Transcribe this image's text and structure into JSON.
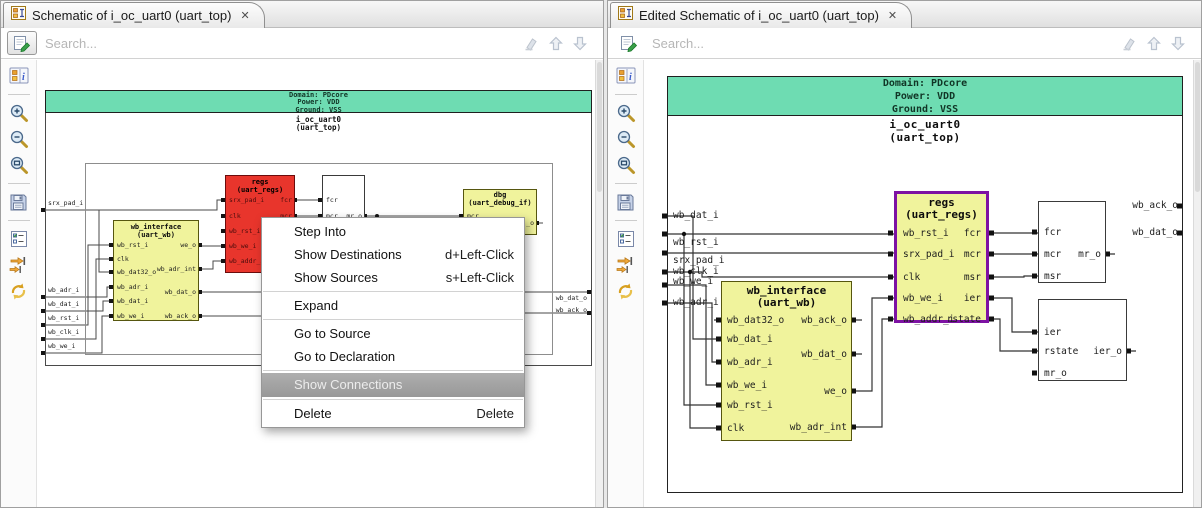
{
  "icons": {
    "close": "✕"
  },
  "left_panel": {
    "tab_title": "Schematic of i_oc_uart0 (uart_top)",
    "search_placeholder": "Search..."
  },
  "right_panel": {
    "tab_title": "Edited Schematic of i_oc_uart0 (uart_top)",
    "search_placeholder": "Search..."
  },
  "header_block": {
    "domain": "Domain: PDcore",
    "power": "Power: VDD",
    "ground": "Ground: VSS",
    "instance": "i_oc_uart0",
    "module": "(uart_top)"
  },
  "left_schematic": {
    "inputs": [
      "srx_pad_i",
      "wb_adr_i",
      "wb_dat_i",
      "wb_rst_i",
      "wb_clk_i",
      "wb_we_i"
    ],
    "outputs": [
      "wb_dat_o",
      "wb_ack_o"
    ],
    "wb_interface": {
      "title": "wb_interface",
      "subtitle": "(uart_wb)",
      "left_ports": [
        "wb_rst_i",
        "clk",
        "wb_dat32_o",
        "wb_adr_i",
        "wb_dat_i",
        "wb_we_i"
      ],
      "right_ports": [
        "we_o",
        "wb_adr_int",
        "wb_dat_o",
        "wb_ack_o"
      ]
    },
    "regs": {
      "title": "regs",
      "subtitle": "(uart_regs)",
      "left_ports": [
        "srx_pad_i",
        "clk",
        "wb_rst_i",
        "wb_we_i",
        "wb_addr_i"
      ],
      "right_ports": [
        "fcr",
        "mcr"
      ]
    },
    "cell": {
      "left_ports": [
        "fcr",
        "mcr"
      ],
      "right_ports": [
        "mr_o"
      ]
    },
    "dbg": {
      "title": "dbg",
      "subtitle": "(uart_debug_if)",
      "left_ports": [
        "mcr"
      ],
      "right_ports": [
        "_o"
      ]
    }
  },
  "right_schematic": {
    "inputs": [
      "wb_dat_i",
      "wb_rst_i",
      "srx_pad_i",
      "wb_clk_i",
      "wb_we_i",
      "wb_adr_i"
    ],
    "outputs": [
      "wb_ack_o",
      "wb_dat_o"
    ],
    "wb_interface": {
      "title": "wb_interface",
      "subtitle": "(uart_wb)",
      "left_ports": [
        "wb_dat32_o",
        "wb_dat_i",
        "wb_adr_i",
        "wb_we_i",
        "wb_rst_i",
        "clk"
      ],
      "right_ports": [
        "wb_ack_o",
        "wb_dat_o",
        "we_o",
        "wb_adr_int"
      ]
    },
    "regs": {
      "title": "regs",
      "subtitle": "(uart_regs)",
      "left_ports": [
        "wb_rst_i",
        "srx_pad_i",
        "clk",
        "wb_we_i",
        "wb_addr_i"
      ],
      "right_ports": [
        "fcr",
        "mcr",
        "msr",
        "ier",
        "rstate"
      ]
    },
    "cell1": {
      "left_ports": [
        "fcr",
        "mcr",
        "msr"
      ],
      "right_ports": [
        "mr_o"
      ]
    },
    "cell2": {
      "left_ports": [
        "ier",
        "rstate",
        "mr_o"
      ],
      "right_ports": [
        "ier_o"
      ]
    }
  },
  "context_menu": {
    "items": [
      {
        "label": "Step Into",
        "shortcut": ""
      },
      {
        "label": "Show Destinations",
        "shortcut": "d+Left-Click"
      },
      {
        "label": "Show Sources",
        "shortcut": "s+Left-Click"
      },
      {
        "label": "Expand",
        "shortcut": ""
      },
      {
        "label": "Go to Source",
        "shortcut": ""
      },
      {
        "label": "Go to Declaration",
        "shortcut": ""
      },
      {
        "label": "Show Connections",
        "shortcut": "",
        "highlighted": true
      },
      {
        "label": "Delete",
        "shortcut": "Delete"
      }
    ]
  },
  "colors": {
    "header_green": "#6EDCB2",
    "block_yellow": "#F0F39C",
    "block_red": "#E8352C",
    "selected_purple": "#7D12A3",
    "menu_highlight": "#A0A0A0"
  }
}
